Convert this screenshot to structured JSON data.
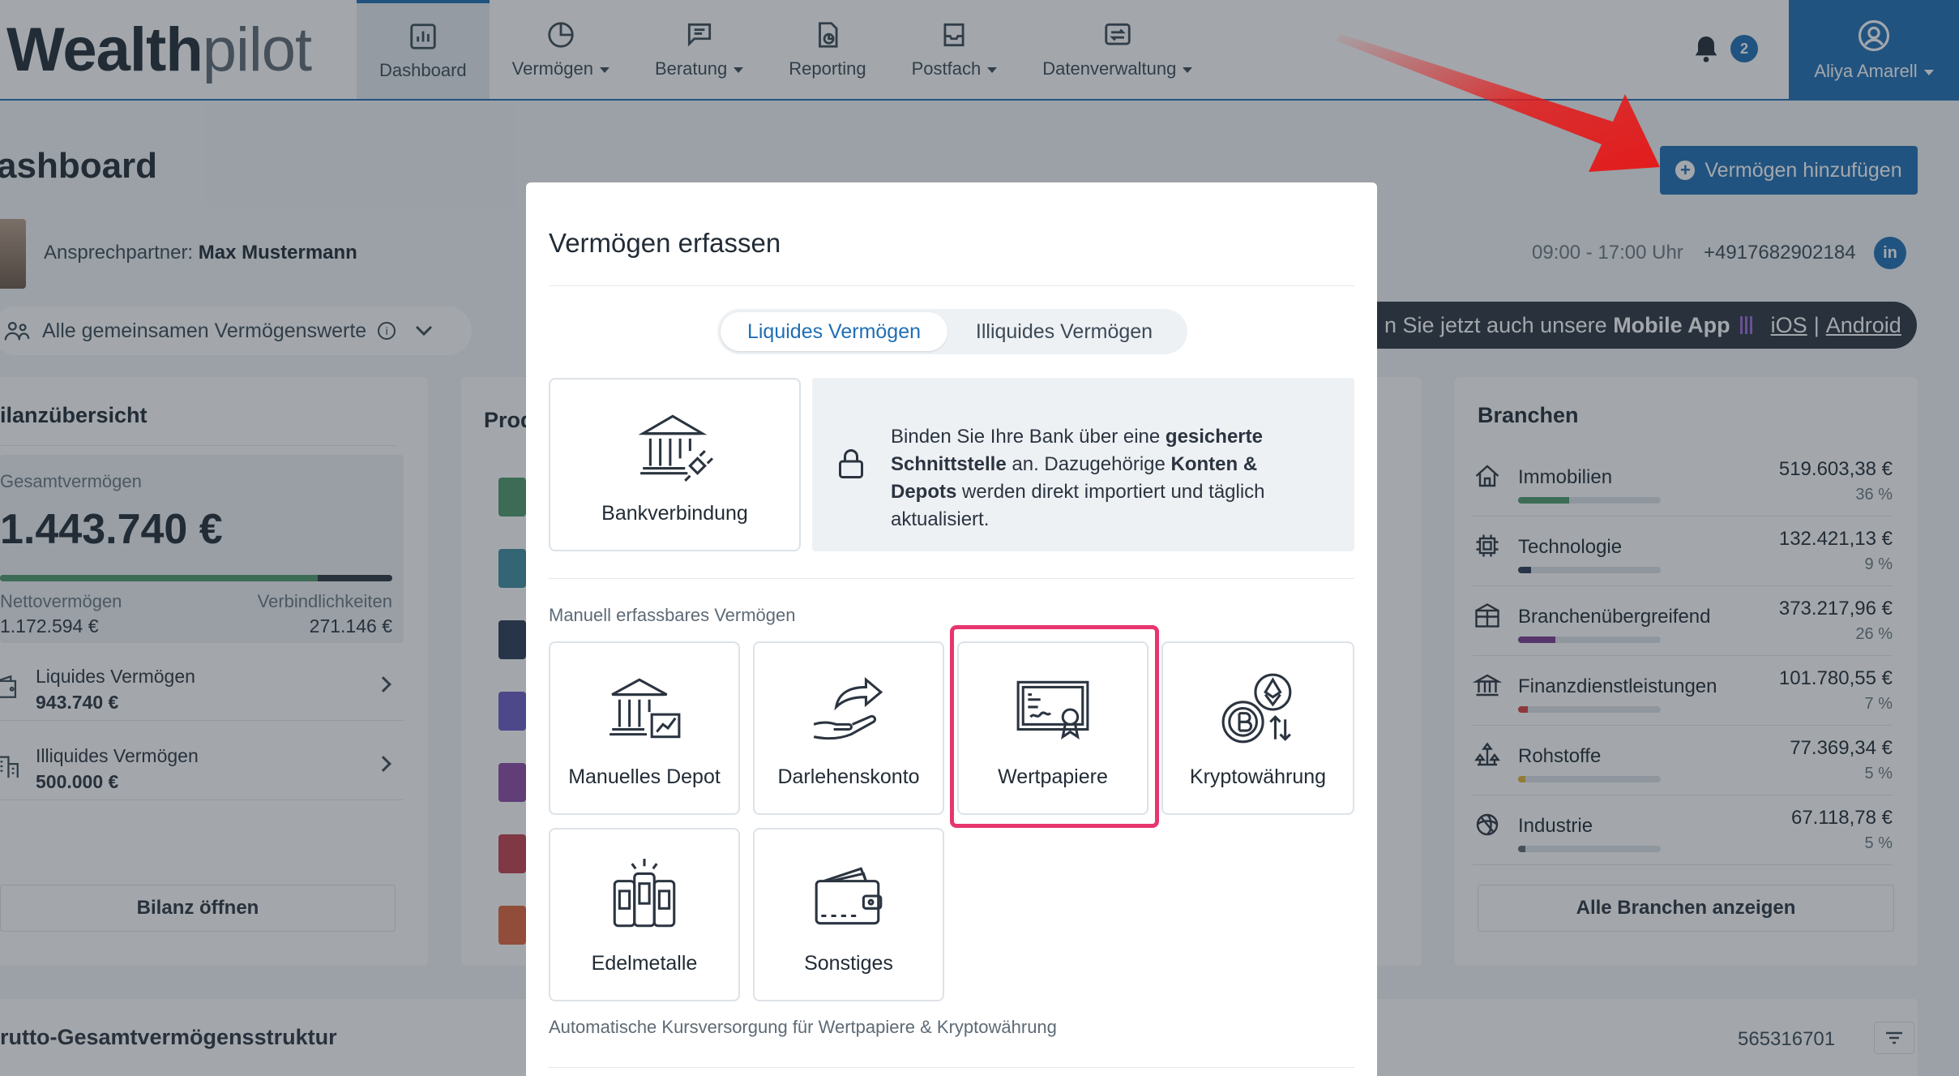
{
  "brand": {
    "logo_part1": "Wealth",
    "logo_part2": "pilot"
  },
  "nav": {
    "items": [
      {
        "label": "Dashboard",
        "icon": "bar-chart-icon"
      },
      {
        "label": "Vermögen",
        "icon": "pie-chart-icon"
      },
      {
        "label": "Beratung",
        "icon": "chat-icon"
      },
      {
        "label": "Reporting",
        "icon": "report-icon"
      },
      {
        "label": "Postfach",
        "icon": "inbox-icon"
      },
      {
        "label": "Datenverwaltung",
        "icon": "data-transfer-icon"
      }
    ],
    "notifications_count": "2",
    "user_name": "Aliya Amarell"
  },
  "page": {
    "title": "ashboard",
    "add_button": "Vermögen hinzufügen"
  },
  "contact": {
    "label": "Ansprechpartner:",
    "name": "Max Mustermann",
    "hours": "09:00 - 17:00 Uhr",
    "phone": "+4917682902184"
  },
  "filter": {
    "label": "Alle gemeinsamen Vermögenswerte"
  },
  "app_banner": {
    "prefix": "n Sie jetzt auch unsere",
    "app": "Mobile App",
    "ios": "iOS",
    "separator": "|",
    "android": "Android"
  },
  "bilanz": {
    "title": "ilanzübersicht",
    "total_label": "Gesamtvermögen",
    "total_value": "1.443.740 €",
    "net_label": "Nettovermögen",
    "net_value": "1.172.594 €",
    "liab_label": "Verbindlichkeiten",
    "liab_value": "271.146 €",
    "net_fraction": 0.81,
    "liquid_label": "Liquides Vermögen",
    "liquid_value": "943.740 €",
    "illiquid_label": "Illiquides Vermögen",
    "illiquid_value": "500.000 €",
    "open_button": "Bilanz öffnen"
  },
  "products": {
    "title": "Prod"
  },
  "branchen": {
    "title": "Branchen",
    "items": [
      {
        "name": "Immobilien",
        "value": "519.603,38 €",
        "pct": "36 %",
        "fraction": 0.36,
        "color": "#4e9a6b"
      },
      {
        "name": "Technologie",
        "value": "132.421,13 €",
        "pct": "9 %",
        "fraction": 0.09,
        "color": "#2b3b55"
      },
      {
        "name": "Branchenübergreifend",
        "value": "373.217,96 €",
        "pct": "26 %",
        "fraction": 0.26,
        "color": "#7a3b8f"
      },
      {
        "name": "Finanzdienstleistungen",
        "value": "101.780,55 €",
        "pct": "7 %",
        "fraction": 0.07,
        "color": "#d94040"
      },
      {
        "name": "Rohstoffe",
        "value": "77.369,34 €",
        "pct": "5 %",
        "fraction": 0.05,
        "color": "#e0b437"
      },
      {
        "name": "Industrie",
        "value": "67.118,78 €",
        "pct": "5 %",
        "fraction": 0.05,
        "color": "#5e6a75"
      }
    ],
    "show_all": "Alle Branchen anzeigen"
  },
  "bottom": {
    "title": "rutto-Gesamtvermögensstruktur",
    "number": "565316701"
  },
  "modal": {
    "title": "Vermögen erfassen",
    "tabs": {
      "liquid": "Liquides Vermögen",
      "illiquid": "Illiquides Vermögen"
    },
    "bank_tile": "Bankverbindung",
    "info_1": "Binden Sie Ihre Bank über eine",
    "info_bold_1": "gesicherte Schnittstelle",
    "info_2": "an. Dazugehörige",
    "info_bold_2": "Konten & Depots",
    "info_3": "werden direkt importiert und täglich aktualisiert.",
    "manual_label": "Manuell erfassbares Vermögen",
    "tiles": {
      "depot": "Manuelles Depot",
      "loan": "Darlehenskonto",
      "securities": "Wertpapiere",
      "crypto": "Kryptowährung",
      "metals": "Edelmetalle",
      "other": "Sonstiges"
    },
    "footer_note": "Automatische Kursversorgung für Wertpapiere & Kryptowährung"
  },
  "colors": {
    "primary": "#1f6fb5",
    "highlight": "#e8356d",
    "arrow": "#e31b1b"
  }
}
